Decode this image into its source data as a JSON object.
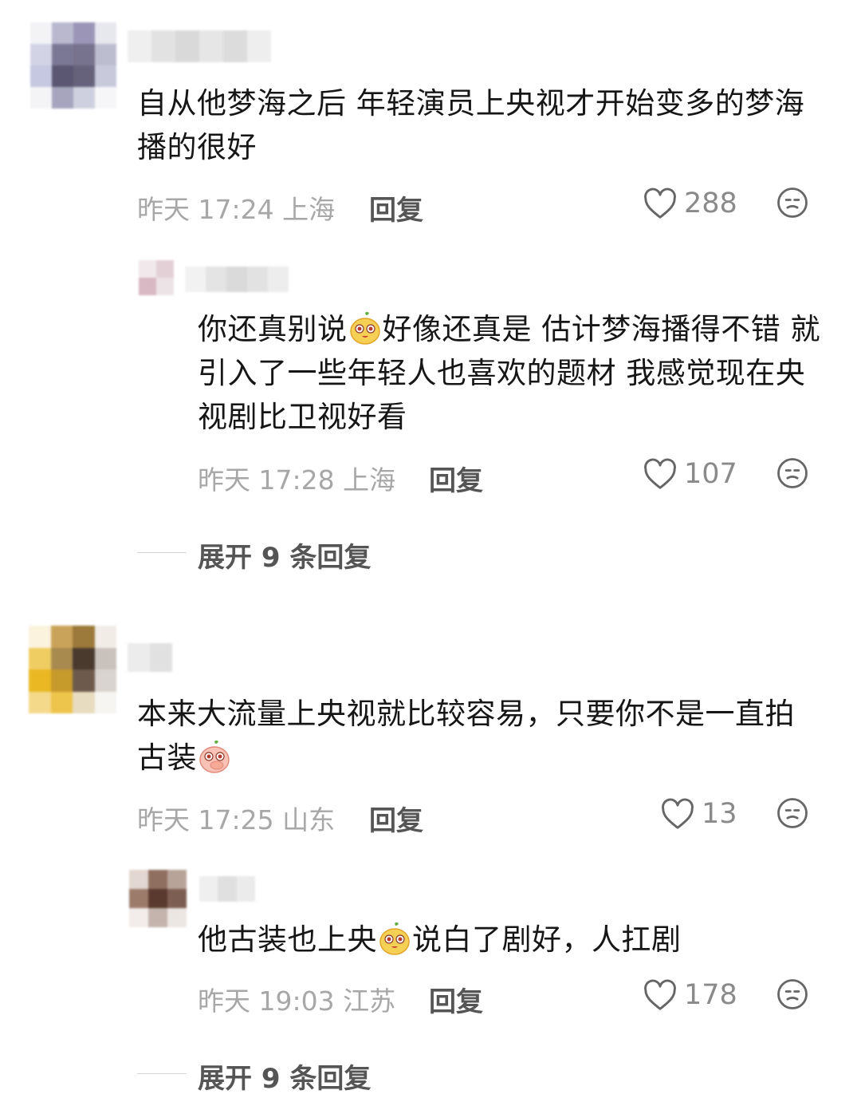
{
  "comments": [
    {
      "text": "自从他梦海之后 年轻演员上央视才开始变多的梦海播的很好",
      "time": "昨天 17:24",
      "location": "上海",
      "reply_label": "回复",
      "likes": "288",
      "replies": [
        {
          "text_a": "你还真别说",
          "text_b": "好像还真是 估计梦海播得不错 就引入了一些年轻人也喜欢的题材 我感觉现在央视剧比卫视好看",
          "time": "昨天 17:28",
          "location": "上海",
          "reply_label": "回复",
          "likes": "107"
        }
      ],
      "expand_label": "展开 9 条回复"
    },
    {
      "text": "本来大流量上央视就比较容易，只要你不是一直拍古装",
      "time": "昨天 17:25",
      "location": "山东",
      "reply_label": "回复",
      "likes": "13",
      "replies": [
        {
          "text_a": "他古装也上央",
          "text_b": "说白了剧好，人扛剧",
          "time": "昨天 19:03",
          "location": "江苏",
          "reply_label": "回复",
          "likes": "178"
        }
      ],
      "expand_label": "展开 9 条回复"
    }
  ],
  "icons": {
    "like": "heart-outline-icon",
    "dislike": "unhappy-face-icon",
    "emoji_1": "yellow-fruit-face-emoji",
    "emoji_2": "peach-cover-mouth-emoji"
  }
}
